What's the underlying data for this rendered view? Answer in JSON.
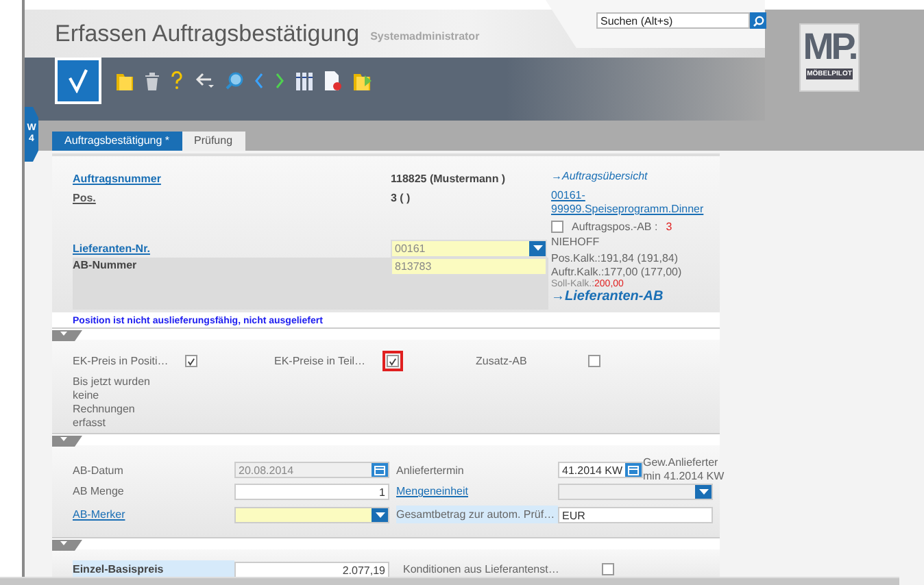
{
  "window": {
    "title": "Erfassen Auftragsbestätigung",
    "user": "Systemadministrator"
  },
  "search": {
    "placeholder": "Suchen (Alt+s)"
  },
  "logo": {
    "mark": "MP.",
    "name": "MÖBELPILOT"
  },
  "side_tab": {
    "label": "W4"
  },
  "tabs": [
    {
      "label": "Auftragsbestätigung *",
      "selected": true
    },
    {
      "label": "Prüfung",
      "selected": false
    }
  ],
  "order": {
    "order_number": {
      "label": "Auftragsnummer",
      "value": "118825 (Mustermann )"
    },
    "position": {
      "label": "Pos.",
      "value": "3 ( )"
    },
    "supplier_number": {
      "label": "Lieferanten-Nr.",
      "value": "00161"
    },
    "ab_number": {
      "label": "AB-Nummer",
      "value": "813783"
    },
    "overview_link": "→Auftragsübersicht",
    "program_link": "00161-99999.Speiseprogramm.Dinner",
    "order_pos_ab": {
      "label": "Auftragspos.-AB :",
      "count": "3",
      "checked": false
    },
    "supplier_name": "NIEHOFF",
    "calc": [
      "Pos.Kalk.:191,84 (191,84)",
      "Auftr.Kalk.:177,00 (177,00)"
    ],
    "target_calc": {
      "label": "Soll-Kalk.:",
      "value": "200,00"
    },
    "supplier_ab_link": "→Lieferanten-AB"
  },
  "status_message": "Position ist nicht auslieferungsfähig, nicht ausgeliefert",
  "panels": [
    {
      "expanded": true
    },
    {
      "expanded": true
    },
    {
      "expanded": true
    }
  ],
  "options": {
    "checks": [
      {
        "label": "EK-Preis in Positi…",
        "checked": true,
        "highlighted": false
      },
      {
        "label": "EK-Preise in Teil…",
        "checked": true,
        "highlighted": true
      },
      {
        "label": "Zusatz-AB",
        "checked": false,
        "highlighted": false
      }
    ],
    "note": "Bis jetzt wurden keine Rechnungen erfasst"
  },
  "ab_fields": [
    {
      "left": {
        "label": "AB-Datum",
        "link": false,
        "highlighted": false,
        "kind": "date",
        "value": "20.08.2014",
        "disabled": true,
        "required": false
      },
      "right": {
        "label": "Anliefertermin",
        "link": false,
        "highlighted": false,
        "kind": "date",
        "value": "41.2014 KW",
        "disabled": false,
        "required": false,
        "note": "Gew.Anlieferter min 41.2014 KW"
      }
    },
    {
      "left": {
        "label": "AB Menge",
        "link": false,
        "highlighted": false,
        "kind": "number",
        "value": "1",
        "disabled": false,
        "required": false
      },
      "right": {
        "label": "Mengeneinheit",
        "link": true,
        "highlighted": false,
        "kind": "select",
        "disabled": true,
        "required": false
      }
    },
    {
      "left": {
        "label": "AB-Merker",
        "link": true,
        "highlighted": false,
        "kind": "select",
        "disabled": false,
        "required": true
      },
      "right": {
        "label": "Gesamtbetrag zur autom. Prüf…",
        "link": false,
        "highlighted": true,
        "kind": "text",
        "value": "EUR",
        "disabled": false,
        "required": false
      }
    }
  ],
  "price": {
    "label": "Einzel-Basispreis",
    "value": "2.077,19",
    "conditions": {
      "label": "Konditionen aus Lieferantenst…",
      "checked": false
    }
  }
}
